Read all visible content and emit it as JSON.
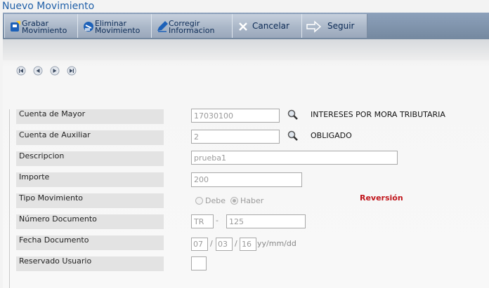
{
  "header": {
    "title": "Nuevo Movimiento"
  },
  "toolbar": {
    "grabar": "Grabar\nMovimiento",
    "eliminar": "Eliminar\nMovimiento",
    "corregir": "Corregir\nInformacion",
    "cancelar": "Cancelar",
    "seguir": "Seguir"
  },
  "nav": [
    "first-icon",
    "previous-icon",
    "next-icon",
    "last-icon"
  ],
  "form": {
    "cuenta_mayor": {
      "label": "Cuenta de Mayor",
      "value": "17030100",
      "description": "INTERESES POR MORA TRIBUTARIA"
    },
    "cuenta_auxiliar": {
      "label": "Cuenta de Auxiliar",
      "value": "2",
      "description": "OBLIGADO"
    },
    "descripcion": {
      "label": "Descripcion",
      "value": "prueba1"
    },
    "importe": {
      "label": "Importe",
      "value": "200"
    },
    "tipo_movimiento": {
      "label": "Tipo Movimiento",
      "option_debe": "Debe",
      "option_haber": "Haber",
      "selected": "Haber",
      "status": "Reversión"
    },
    "numero_documento": {
      "label": "Número Documento",
      "prefix": "TR",
      "separator": "-",
      "value": "125"
    },
    "fecha_documento": {
      "label": "Fecha Documento",
      "day": "07",
      "month": "03",
      "year": "16",
      "separator": "/",
      "format": "yy/mm/dd"
    },
    "reservado_usuario": {
      "label": "Reservado Usuario",
      "value": ""
    }
  },
  "colors": {
    "title": "#1f5fa8",
    "toolbar": "#74889f",
    "status": "#c0151b"
  }
}
